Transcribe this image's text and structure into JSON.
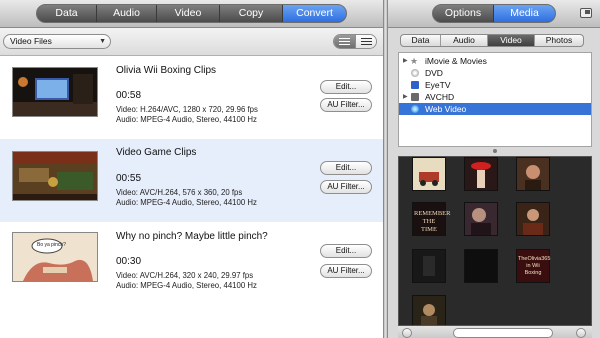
{
  "left_tabs": [
    "Data",
    "Audio",
    "Video",
    "Copy",
    "Convert"
  ],
  "left_tabs_active": "Convert",
  "right_tabs": [
    "Options",
    "Media"
  ],
  "right_tabs_active": "Media",
  "filter": {
    "selected": "Video Files"
  },
  "clips": [
    {
      "title": "Olivia Wii Boxing Clips",
      "duration": "00:58",
      "video": "Video: H.264/AVC, 1280 x 720, 29.96 fps",
      "audio": "Audio: MPEG-4 Audio, Stereo, 44100 Hz",
      "edit_label": "Edit...",
      "filter_label": "AU Filter...",
      "selected": false
    },
    {
      "title": "Video Game Clips",
      "duration": "00:55",
      "video": "Video: AVC/H.264, 576 x 360, 20 fps",
      "audio": "Audio: MPEG-4 Audio, Stereo, 44100 Hz",
      "edit_label": "Edit...",
      "filter_label": "AU Filter...",
      "selected": true
    },
    {
      "title": "Why no pinch? Maybe little pinch?",
      "duration": "00:30",
      "video": "Video: AVC/H.264, 320 x 240, 29.97 fps",
      "audio": "Audio: MPEG-4 Audio, Stereo, 44100 Hz",
      "edit_label": "Edit...",
      "filter_label": "AU Filter...",
      "selected": false
    }
  ],
  "media_tabs": [
    "Data",
    "Audio",
    "Video",
    "Photos"
  ],
  "media_tabs_active": "Video",
  "sources": [
    {
      "label": "iMovie & Movies",
      "icon": "star-icon",
      "color": "#8a8a8a"
    },
    {
      "label": "DVD",
      "icon": "disc-icon",
      "color": "#b9b9b9"
    },
    {
      "label": "EyeTV",
      "icon": "tv-icon",
      "color": "#2e62c9"
    },
    {
      "label": "AVCHD",
      "icon": "camcorder-icon",
      "color": "#6a6a6a"
    },
    {
      "label": "Web Video",
      "icon": "globe-icon",
      "color": "#3aa0e8"
    }
  ],
  "sources_selected": "Web Video",
  "thumb_texts": {
    "remember": "REMEMBER THE TIME",
    "olivia": "TheOlivia365 in Wii Boxing",
    "speech": "Bo ya pinch?"
  }
}
